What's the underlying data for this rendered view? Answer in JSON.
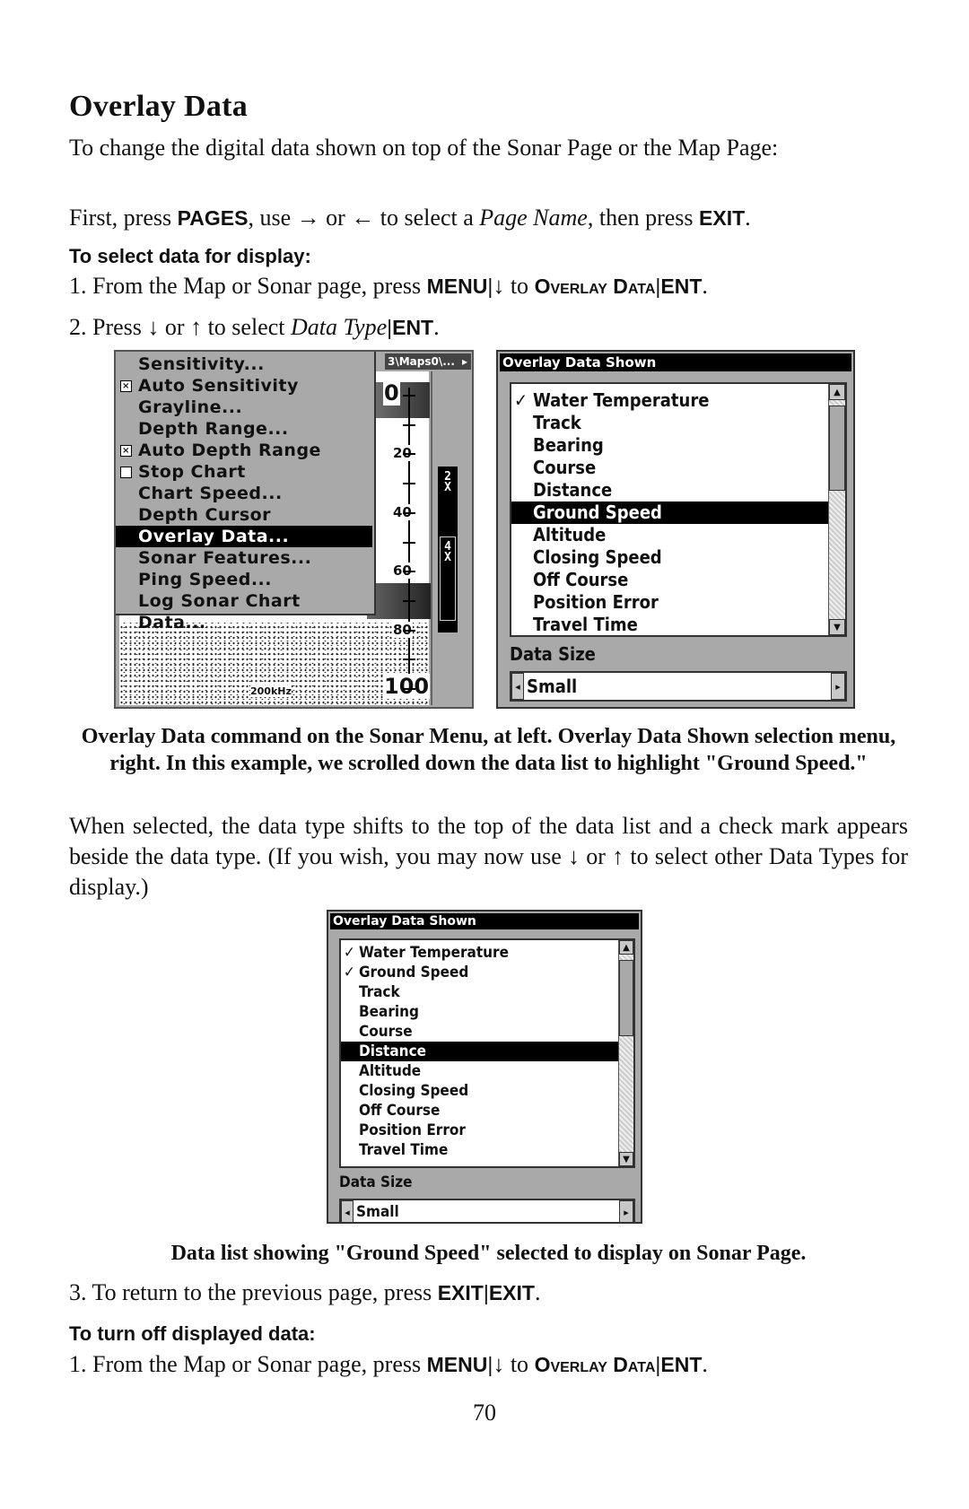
{
  "heading": "Overlay Data",
  "intro": "To change the digital data shown on top of the Sonar Page or the Map Page:",
  "first": {
    "prefix": "First, press ",
    "key_pages": "PAGES",
    "mid1": ", use ",
    "arrow_right": "→",
    "or": " or ",
    "arrow_left": "←",
    "mid2": " to select a ",
    "page_name": "Page Name",
    "mid3": ", then press ",
    "key_exit": "EXIT",
    "end": "."
  },
  "select_heading": "To select data for display:",
  "step1": {
    "prefix": "1. From the Map or Sonar page, press ",
    "key_menu": "MENU",
    "sep": "|",
    "arrow_down": "↓",
    "to": " to ",
    "overlay_data": "Overlay Data",
    "key_ent": "ENT",
    "end": "."
  },
  "step2": {
    "prefix": "2. Press ",
    "arrow_down": "↓",
    "or": " or ",
    "arrow_up": "↑",
    "mid": " to select ",
    "data_type": "Data Type",
    "sep": "|",
    "key_ent": "ENT",
    "end": "."
  },
  "sonar_screen": {
    "path_label": "3\\Maps0\\...",
    "path_arrow": "▸",
    "menu_items": [
      {
        "label": "Sensitivity...",
        "checkbox": null,
        "selected": false
      },
      {
        "label": "Auto Sensitivity",
        "checkbox": "checked",
        "selected": false
      },
      {
        "label": "Grayline...",
        "checkbox": null,
        "selected": false
      },
      {
        "label": "Depth Range...",
        "checkbox": null,
        "selected": false
      },
      {
        "label": "Auto Depth Range",
        "checkbox": "checked",
        "selected": false
      },
      {
        "label": "Stop Chart",
        "checkbox": "unchecked",
        "selected": false
      },
      {
        "label": "Chart Speed...",
        "checkbox": null,
        "selected": false
      },
      {
        "label": "Depth Cursor",
        "checkbox": null,
        "selected": false
      },
      {
        "label": "Overlay Data...",
        "checkbox": null,
        "selected": true
      },
      {
        "label": "Sonar Features...",
        "checkbox": null,
        "selected": false
      },
      {
        "label": "Ping Speed...",
        "checkbox": null,
        "selected": false
      },
      {
        "label": "Log Sonar Chart Data...",
        "checkbox": null,
        "selected": false
      }
    ],
    "depth_labels": [
      "0",
      "20",
      "40",
      "60",
      "80",
      "100"
    ],
    "frequency": "200kHz",
    "zoom_labels": [
      "2\nX",
      "4\nX"
    ]
  },
  "dialog1": {
    "title": "Overlay Data Shown",
    "items": [
      {
        "label": "Water Temperature",
        "checked": true,
        "selected": false
      },
      {
        "label": "Track",
        "checked": false,
        "selected": false
      },
      {
        "label": "Bearing",
        "checked": false,
        "selected": false
      },
      {
        "label": "Course",
        "checked": false,
        "selected": false
      },
      {
        "label": "Distance",
        "checked": false,
        "selected": false
      },
      {
        "label": "Ground Speed",
        "checked": false,
        "selected": true
      },
      {
        "label": "Altitude",
        "checked": false,
        "selected": false
      },
      {
        "label": "Closing Speed",
        "checked": false,
        "selected": false
      },
      {
        "label": "Off Course",
        "checked": false,
        "selected": false
      },
      {
        "label": "Position Error",
        "checked": false,
        "selected": false
      },
      {
        "label": "Travel Time",
        "checked": false,
        "selected": false
      }
    ],
    "check_glyph": "✓",
    "data_size_label": "Data Size",
    "data_size_value": "Small",
    "arrow_left": "◂",
    "arrow_right": "▸",
    "scroll_up": "▲",
    "scroll_down": "▼"
  },
  "caption1": "Overlay Data command on the Sonar Menu, at left. Overlay Data Shown selection menu, right. In this example, we scrolled down the data list to highlight \"Ground Speed.\"",
  "para_selected": {
    "prefix": "When selected, the data type shifts to the top of the data list and a check mark appears beside the data type. (If you wish, you may now use ",
    "arrow_down": "↓",
    "or": " or ",
    "arrow_up": "↑",
    "suffix": " to select other Data Types for display.)"
  },
  "dialog2": {
    "title": "Overlay Data Shown",
    "items": [
      {
        "label": "Water Temperature",
        "checked": true,
        "selected": false
      },
      {
        "label": "Ground Speed",
        "checked": true,
        "selected": false
      },
      {
        "label": "Track",
        "checked": false,
        "selected": false
      },
      {
        "label": "Bearing",
        "checked": false,
        "selected": false
      },
      {
        "label": "Course",
        "checked": false,
        "selected": false
      },
      {
        "label": "Distance",
        "checked": false,
        "selected": true
      },
      {
        "label": "Altitude",
        "checked": false,
        "selected": false
      },
      {
        "label": "Closing Speed",
        "checked": false,
        "selected": false
      },
      {
        "label": "Off Course",
        "checked": false,
        "selected": false
      },
      {
        "label": "Position Error",
        "checked": false,
        "selected": false
      },
      {
        "label": "Travel Time",
        "checked": false,
        "selected": false
      }
    ],
    "check_glyph": "✓",
    "data_size_label": "Data Size",
    "data_size_value": "Small",
    "arrow_left": "◂",
    "arrow_right": "▸",
    "scroll_up": "▲",
    "scroll_down": "▼"
  },
  "caption2": "Data list showing \"Ground Speed\" selected to display on Sonar Page.",
  "step3": {
    "prefix": "3. To return to the previous page, press ",
    "key_exit1": "EXIT",
    "sep": "|",
    "key_exit2": "EXIT",
    "end": "."
  },
  "turnoff_heading": "To turn off displayed data:",
  "step1b": {
    "prefix": "1. From the Map or Sonar page, press ",
    "key_menu": "MENU",
    "sep": "|",
    "arrow_down": "↓",
    "to": " to ",
    "overlay_data": "Overlay Data",
    "key_ent": "ENT",
    "end": "."
  },
  "page_number": "70"
}
